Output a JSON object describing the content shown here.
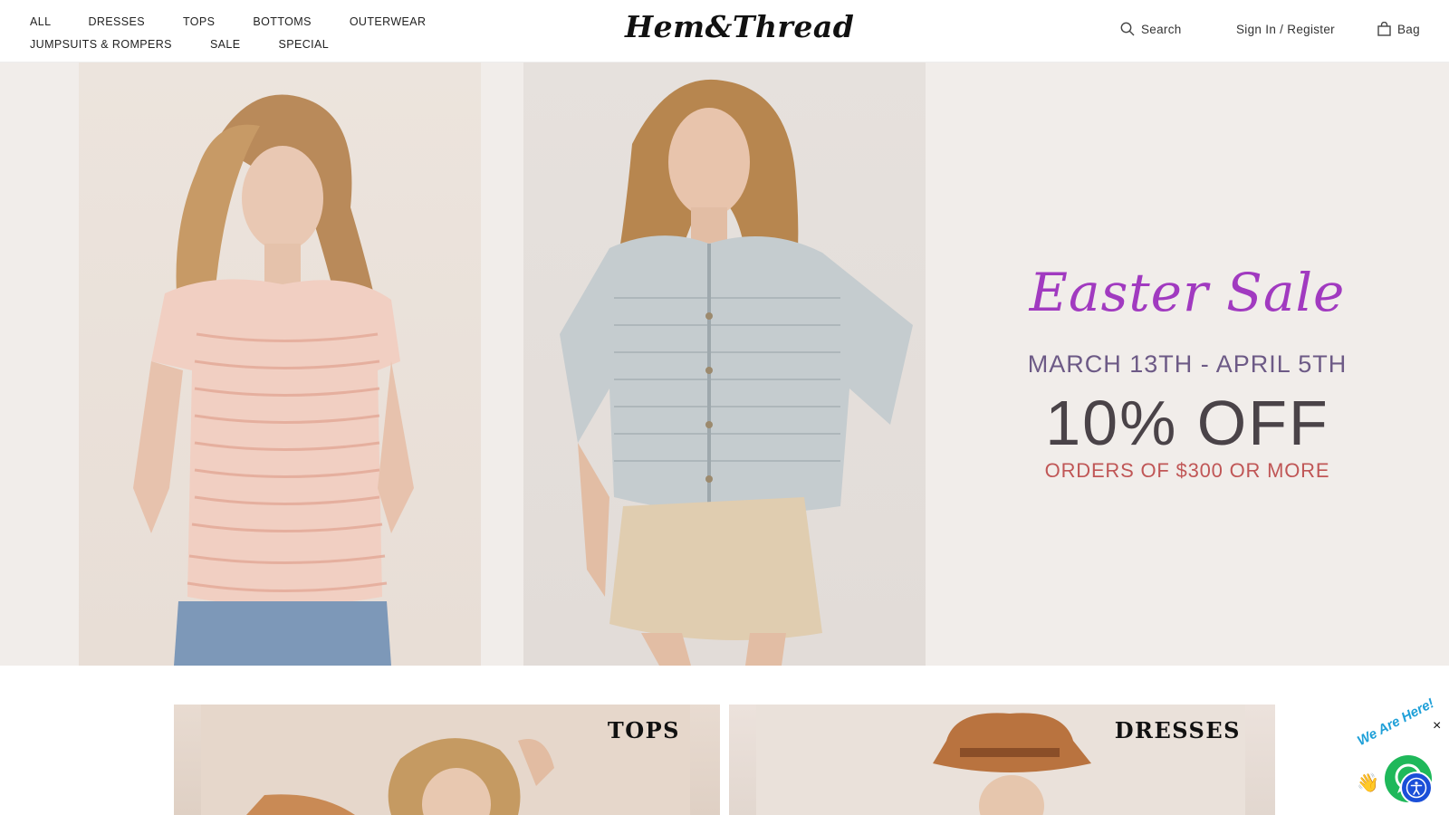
{
  "header": {
    "nav_row1": [
      "ALL",
      "DRESSES",
      "TOPS",
      "BOTTOMS",
      "OUTERWEAR"
    ],
    "nav_row2": [
      "JUMPSUITS & ROMPERS",
      "SALE",
      "SPECIAL"
    ],
    "logo": "Hem&Thread",
    "search_label": "Search",
    "account_label": "Sign In / Register",
    "bag_label": "Bag"
  },
  "hero": {
    "headline": "Easter Sale",
    "dates": "MARCH 13TH - APRIL 5TH",
    "discount": "10% OFF",
    "terms": "ORDERS OF $300 OR MORE"
  },
  "categories": [
    {
      "title": "TOPS"
    },
    {
      "title": "DRESSES"
    }
  ],
  "chat": {
    "badge": "We Are Here!",
    "close": "×"
  },
  "colors": {
    "easter": "#a13ac0",
    "dates": "#6d5a86",
    "discount": "#4a4348",
    "terms": "#c05656",
    "chat": "#1fb85a",
    "accessibility": "#1b4fd8"
  },
  "icons": [
    "search-icon",
    "bag-icon",
    "chat-icon",
    "accessibility-icon",
    "close-icon"
  ]
}
